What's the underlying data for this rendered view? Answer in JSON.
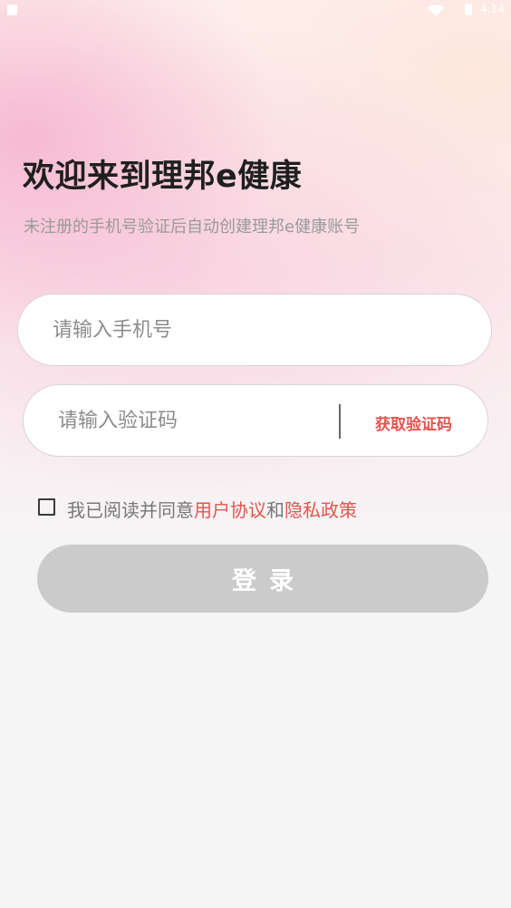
{
  "status_bar": {
    "time": "4:14",
    "left_icon": "notification-icon",
    "wifi_icon": "wifi-icon",
    "battery_icon": "battery-icon"
  },
  "header": {
    "title": "欢迎来到理邦e健康",
    "subtitle": "未注册的手机号验证后自动创建理邦e健康账号"
  },
  "form": {
    "phone_placeholder": "请输入手机号",
    "phone_value": "",
    "code_placeholder": "请输入验证码",
    "code_value": "",
    "get_code_label": "获取验证码"
  },
  "agreement": {
    "checked": false,
    "prefix": "我已阅读并同意",
    "user_agreement": "用户协议",
    "conjunction": "和",
    "privacy_policy": "隐私政策"
  },
  "login": {
    "label": "登录"
  },
  "colors": {
    "accent": "#e5544e",
    "button_disabled": "#cbcbcb",
    "title": "#1f1f1f",
    "subtitle": "#9a9a9a"
  }
}
